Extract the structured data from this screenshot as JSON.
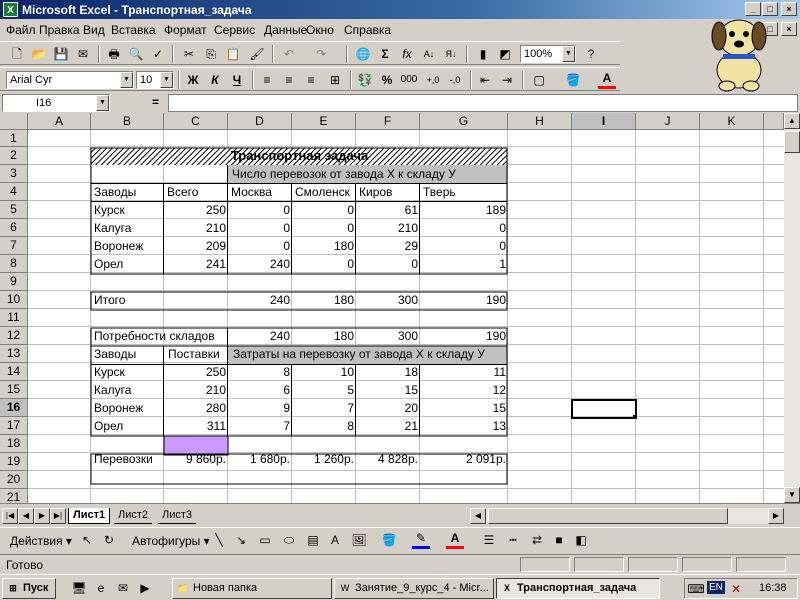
{
  "window": {
    "title": "Microsoft Excel - Транспортная_задача",
    "app_icon": "excel-icon"
  },
  "menu": [
    "Файл",
    "Правка",
    "Вид",
    "Вставка",
    "Формат",
    "Сервис",
    "Данные",
    "Окно",
    "Справка"
  ],
  "toolbar": {
    "zoom": "100%",
    "font": "Arial Cyr",
    "font_size": "10",
    "bold": "Ж",
    "italic": "К",
    "underline": "Ч",
    "percent": "%",
    "thousands": "000"
  },
  "formula_bar": {
    "name_box": "I16",
    "equals": "=",
    "value": ""
  },
  "columns": [
    "A",
    "B",
    "C",
    "D",
    "E",
    "F",
    "G",
    "H",
    "I",
    "J",
    "K"
  ],
  "rows": [
    "1",
    "2",
    "3",
    "4",
    "5",
    "6",
    "7",
    "8",
    "9",
    "10",
    "11",
    "12",
    "13",
    "14",
    "15",
    "16",
    "17",
    "18",
    "19",
    "20",
    "21"
  ],
  "cells": {
    "title": "Транспортная задача",
    "header_ship": "Число перевозок от завода  Х к складу  У",
    "factories_label": "Заводы",
    "total_label": "Всего",
    "warehouses": [
      "Москва",
      "Смоленск",
      "Киров",
      "Тверь"
    ],
    "shipments": [
      {
        "factory": "Курск",
        "total": "250",
        "values": [
          "0",
          "0",
          "61",
          "189"
        ]
      },
      {
        "factory": "Калуга",
        "total": "210",
        "values": [
          "0",
          "0",
          "210",
          "0"
        ]
      },
      {
        "factory": "Воронеж",
        "total": "209",
        "values": [
          "0",
          "180",
          "29",
          "0"
        ]
      },
      {
        "factory": "Орел",
        "total": "241",
        "values": [
          "240",
          "0",
          "0",
          "1"
        ]
      }
    ],
    "itogo_label": "Итого",
    "itogo": [
      "240",
      "180",
      "300",
      "190"
    ],
    "needs_label": "Потребности складов",
    "needs": [
      "240",
      "180",
      "300",
      "190"
    ],
    "factories_label2": "Заводы",
    "supply_label": "Поставки",
    "cost_header": "Затраты на перевозку от завода Х к складу  У",
    "costs": [
      {
        "factory": "Курск",
        "supply": "250",
        "values": [
          "8",
          "10",
          "18",
          "11"
        ]
      },
      {
        "factory": "Калуга",
        "supply": "210",
        "values": [
          "6",
          "5",
          "15",
          "12"
        ]
      },
      {
        "factory": "Воронеж",
        "supply": "280",
        "values": [
          "9",
          "7",
          "20",
          "15"
        ]
      },
      {
        "factory": "Орел",
        "supply": "311",
        "values": [
          "7",
          "8",
          "21",
          "13"
        ]
      }
    ],
    "transport_label": "Перевозки",
    "transport_total": "9 860р.",
    "transport": [
      "1 680р.",
      "1 260р.",
      "4 828р.",
      "2 091р."
    ]
  },
  "sheet_tabs": [
    "Лист1",
    "Лист2",
    "Лист3"
  ],
  "active_sheet": "Лист1",
  "draw_toolbar": {
    "actions": "Действия",
    "autoshapes": "Автофигуры"
  },
  "status": "Готово",
  "taskbar": {
    "start": "Пуск",
    "items": [
      "Новая папка",
      "Занятие_9_курс_4 - Micr...",
      "Транспортная_задача"
    ],
    "lang": "EN",
    "clock": "16:38"
  },
  "colors": {
    "highlight": "#cc99ff",
    "gray_fill": "#c0c0c0",
    "title_bar": "#0a246a"
  }
}
